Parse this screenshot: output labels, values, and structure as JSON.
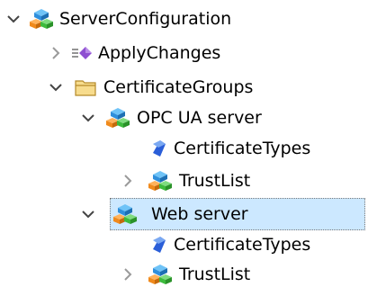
{
  "colors": {
    "selection_fill": "#cce8ff",
    "selection_border": "#7a7a7a",
    "expand_arrow": "#444444",
    "collapse_arrow": "#9a9a9a",
    "node_object_blue": "#2f8fdc",
    "node_object_green": "#3dbb3d",
    "node_object_orange": "#f08a1c",
    "folder_yellow": "#e8c15a",
    "method_purple": "#8e4fd1",
    "variable_blue": "#2a5ed8"
  },
  "tree": {
    "root": {
      "label": "ServerConfiguration",
      "expanded": true,
      "icon": "object-icon",
      "children": {
        "apply_changes": {
          "label": "ApplyChanges",
          "expanded": false,
          "icon": "method-icon"
        },
        "certificate_groups": {
          "label": "CertificateGroups",
          "expanded": true,
          "icon": "folder-icon",
          "children": {
            "opc_ua_server": {
              "label": "OPC UA server",
              "expanded": true,
              "icon": "object-icon",
              "children": {
                "certificate_types": {
                  "label": "CertificateTypes",
                  "icon": "variable-icon"
                },
                "trust_list": {
                  "label": "TrustList",
                  "expanded": false,
                  "icon": "object-icon"
                }
              }
            },
            "web_server": {
              "label": "Web server",
              "expanded": true,
              "selected": true,
              "icon": "object-icon",
              "children": {
                "certificate_types": {
                  "label": "CertificateTypes",
                  "icon": "variable-icon"
                },
                "trust_list": {
                  "label": "TrustList",
                  "expanded": false,
                  "icon": "object-icon"
                }
              }
            }
          }
        }
      }
    }
  }
}
